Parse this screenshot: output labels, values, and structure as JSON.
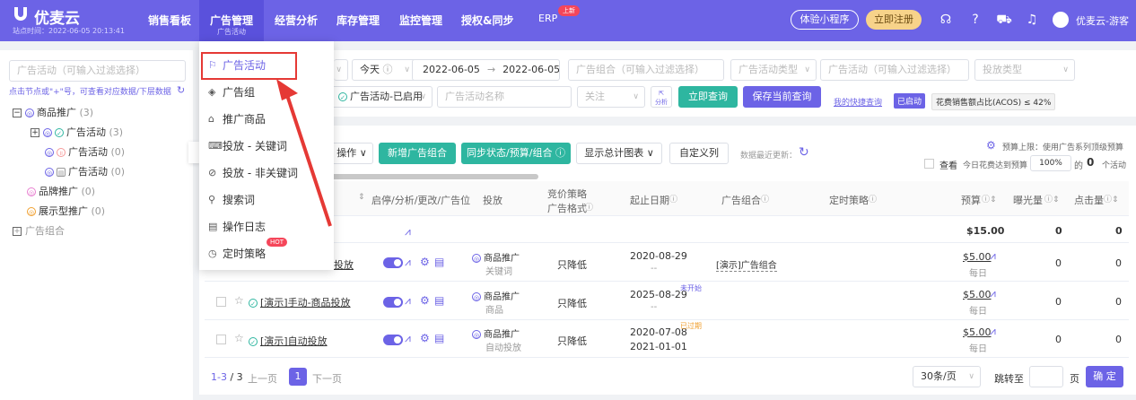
{
  "header": {
    "logo": "优麦云",
    "site_time": "站点时间：2022-06-05 20:13:41",
    "nav": [
      {
        "label": "销售看板"
      },
      {
        "label": "广告管理",
        "sub": "广告活动"
      },
      {
        "label": "经营分析"
      },
      {
        "label": "库存管理"
      },
      {
        "label": "监控管理"
      },
      {
        "label": "授权&同步"
      },
      {
        "label": "ERP",
        "badge": "上新"
      }
    ],
    "mini_program_btn": "体验小程序",
    "register_btn": "立即注册",
    "username": "优麦云-游客"
  },
  "sidebar": {
    "filter_placeholder": "广告活动（可输入过滤选择）",
    "hint": "点击节点或\"+\"号，可查看对应数据/下层数据",
    "tree": [
      {
        "label": "商品推广",
        "count": "(3)"
      },
      {
        "label": "广告活动",
        "count": "(3)"
      },
      {
        "label": "广告活动",
        "count": "(0)"
      },
      {
        "label": "广告活动",
        "count": "(0)"
      },
      {
        "label": "品牌推广",
        "count": "(0)"
      },
      {
        "label": "展示型推广",
        "count": "(0)"
      },
      {
        "label": "广告组合",
        "count": ""
      }
    ]
  },
  "dropdown_menu": {
    "items": [
      {
        "label": "广告活动",
        "icon": "flag-icon"
      },
      {
        "label": "广告组",
        "icon": "layers-icon"
      },
      {
        "label": "推广商品",
        "icon": "product-icon"
      },
      {
        "label": "投放 - 关键词",
        "icon": "keyword-icon"
      },
      {
        "label": "投放 - 非关键词",
        "icon": "target-icon"
      },
      {
        "label": "搜索词",
        "icon": "search-icon"
      },
      {
        "label": "操作日志",
        "icon": "log-icon"
      },
      {
        "label": "定时策略",
        "icon": "clock-icon"
      }
    ],
    "hot_badge": "HOT"
  },
  "filters": {
    "period": "今天",
    "date_start": "2022-06-05",
    "date_arrow": "→",
    "date_end": "2022-06-05",
    "portfolio_placeholder": "广告组合（可输入过滤选择）",
    "campaign_type_placeholder": "广告活动类型",
    "campaign_filter_placeholder": "广告活动（可输入过滤选择）",
    "targeting_type_placeholder": "投放类型",
    "status_value": "广告活动-已启用",
    "campaign_name_placeholder": "广告活动名称",
    "follow_placeholder": "关注",
    "analysis_label": "分析",
    "query_btn": "立即查询",
    "save_query_btn": "保存当前查询",
    "my_shortcut": "我的快捷查询",
    "tag_enabled": "已启动",
    "tag_acos": "花费销售额占比(ACOS) ≤ 42%"
  },
  "toolbar": {
    "operate_btn": "操作",
    "add_portfolio_btn": "新增广告组合",
    "sync_btn": "同步状态/预算/组合",
    "show_chart_btn": "显示总计图表",
    "custom_cols_btn": "自定义列",
    "last_update": "数据最近更新：",
    "budget_limit": "预算上限：使用广告系列顶级预算",
    "view_label": "查看",
    "today_cost_label": "今日花费达到预算",
    "percent_value": "100%",
    "of_label": "的",
    "campaign_count": "0",
    "campaign_unit": "个活动"
  },
  "table": {
    "headers": {
      "toggle": "启停/分析/更改/广告位",
      "targeting": "投放",
      "bid_strategy": "竞价策略",
      "ad_format": "广告格式",
      "dates": "起止日期",
      "portfolio": "广告组合",
      "schedule": "定时策略",
      "budget": "预算",
      "impressions": "曝光量",
      "clicks": "点击量"
    },
    "summary": {
      "budget": "$15.00",
      "impressions": "0",
      "clicks": "0"
    },
    "rows": [
      {
        "name": "投放",
        "type": "商品推广",
        "target": "关键词",
        "bid": "只降低",
        "start": "2020-08-29",
        "end": "--",
        "status": "",
        "portfolio": "[演示]广告组合",
        "budget": "$5.00",
        "budget_unit": "每日",
        "impressions": "0",
        "clicks": "0"
      },
      {
        "name": "[演示]手动-商品投放",
        "type": "商品推广",
        "target": "商品",
        "bid": "只降低",
        "start": "2025-08-29",
        "end": "--",
        "status": "未开始",
        "portfolio": "",
        "budget": "$5.00",
        "budget_unit": "每日",
        "impressions": "0",
        "clicks": "0"
      },
      {
        "name": "[演示]自动投放",
        "type": "商品推广",
        "target": "自动投放",
        "bid": "只降低",
        "start": "2020-07-08",
        "end": "2021-01-01",
        "status": "已过期",
        "portfolio": "",
        "budget": "$5.00",
        "budget_unit": "每日",
        "impressions": "0",
        "clicks": "0"
      }
    ]
  },
  "pagination": {
    "range": "1-3",
    "total": "/ 3",
    "prev": "上一页",
    "current": "1",
    "next": "下一页",
    "page_size": "30条/页",
    "jump_label": "跳转至",
    "page_unit": "页",
    "confirm": "确 定"
  },
  "colors": {
    "brand": "#6c63e6",
    "green": "#2eb6a0",
    "red": "#e53935"
  }
}
